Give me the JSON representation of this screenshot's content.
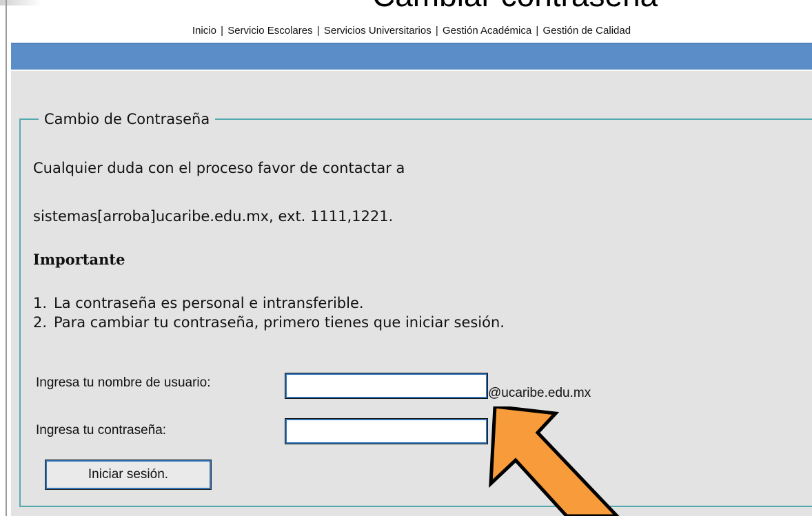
{
  "page_heading": "Cambiar contraseña",
  "nav": {
    "items": [
      "Inicio",
      "Servicio Escolares",
      "Servicios Universitarios",
      "Gestión Académica",
      "Gestión de Calidad"
    ],
    "separator": "|"
  },
  "form": {
    "legend": "Cambio de Contraseña",
    "contact_line1": "Cualquier duda con el proceso favor de contactar a",
    "contact_line2": "sistemas[arroba]ucaribe.edu.mx, ext. 1111,1221.",
    "important_heading": "Importante",
    "rules": [
      {
        "num": "1.",
        "text": "La contraseña es personal e intransferible."
      },
      {
        "num": "2.",
        "text": "Para cambiar tu contraseña, primero tienes que iniciar sesión."
      }
    ],
    "username_label": "Ingresa tu nombre de usuario:",
    "username_value": "",
    "username_suffix": "@ucaribe.edu.mx",
    "password_label": "Ingresa tu contraseña:",
    "password_value": "",
    "submit_label": "Iniciar sesión."
  },
  "colors": {
    "nav_bar": "#5b8dc8",
    "panel": "#e3e3e3",
    "fieldset_border": "#55aab0",
    "input_border": "#2f73b5",
    "arrow_fill": "#f89b3a"
  },
  "icons": [
    "annotation-arrow-icon"
  ]
}
